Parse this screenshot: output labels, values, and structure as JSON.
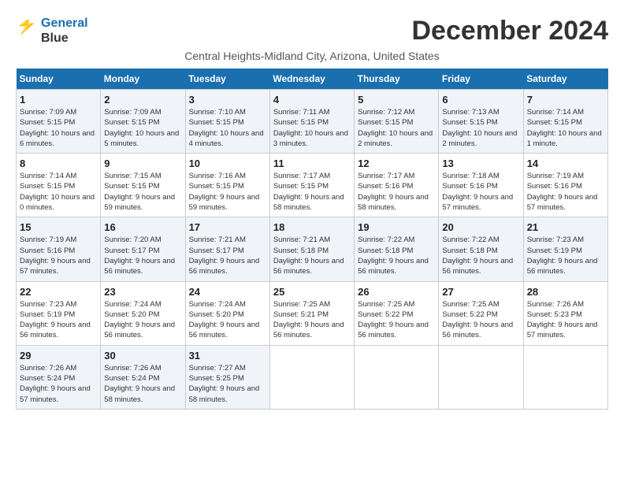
{
  "logo": {
    "line1": "General",
    "line2": "Blue"
  },
  "title": "December 2024",
  "subtitle": "Central Heights-Midland City, Arizona, United States",
  "header": {
    "colors": {
      "accent": "#1a6faf"
    }
  },
  "weekdays": [
    "Sunday",
    "Monday",
    "Tuesday",
    "Wednesday",
    "Thursday",
    "Friday",
    "Saturday"
  ],
  "weeks": [
    [
      {
        "day": "1",
        "sunrise": "7:09 AM",
        "sunset": "5:15 PM",
        "daylight": "10 hours and 6 minutes."
      },
      {
        "day": "2",
        "sunrise": "7:09 AM",
        "sunset": "5:15 PM",
        "daylight": "10 hours and 5 minutes."
      },
      {
        "day": "3",
        "sunrise": "7:10 AM",
        "sunset": "5:15 PM",
        "daylight": "10 hours and 4 minutes."
      },
      {
        "day": "4",
        "sunrise": "7:11 AM",
        "sunset": "5:15 PM",
        "daylight": "10 hours and 3 minutes."
      },
      {
        "day": "5",
        "sunrise": "7:12 AM",
        "sunset": "5:15 PM",
        "daylight": "10 hours and 2 minutes."
      },
      {
        "day": "6",
        "sunrise": "7:13 AM",
        "sunset": "5:15 PM",
        "daylight": "10 hours and 2 minutes."
      },
      {
        "day": "7",
        "sunrise": "7:14 AM",
        "sunset": "5:15 PM",
        "daylight": "10 hours and 1 minute."
      }
    ],
    [
      {
        "day": "8",
        "sunrise": "7:14 AM",
        "sunset": "5:15 PM",
        "daylight": "10 hours and 0 minutes."
      },
      {
        "day": "9",
        "sunrise": "7:15 AM",
        "sunset": "5:15 PM",
        "daylight": "9 hours and 59 minutes."
      },
      {
        "day": "10",
        "sunrise": "7:16 AM",
        "sunset": "5:15 PM",
        "daylight": "9 hours and 59 minutes."
      },
      {
        "day": "11",
        "sunrise": "7:17 AM",
        "sunset": "5:15 PM",
        "daylight": "9 hours and 58 minutes."
      },
      {
        "day": "12",
        "sunrise": "7:17 AM",
        "sunset": "5:16 PM",
        "daylight": "9 hours and 58 minutes."
      },
      {
        "day": "13",
        "sunrise": "7:18 AM",
        "sunset": "5:16 PM",
        "daylight": "9 hours and 57 minutes."
      },
      {
        "day": "14",
        "sunrise": "7:19 AM",
        "sunset": "5:16 PM",
        "daylight": "9 hours and 57 minutes."
      }
    ],
    [
      {
        "day": "15",
        "sunrise": "7:19 AM",
        "sunset": "5:16 PM",
        "daylight": "9 hours and 57 minutes."
      },
      {
        "day": "16",
        "sunrise": "7:20 AM",
        "sunset": "5:17 PM",
        "daylight": "9 hours and 56 minutes."
      },
      {
        "day": "17",
        "sunrise": "7:21 AM",
        "sunset": "5:17 PM",
        "daylight": "9 hours and 56 minutes."
      },
      {
        "day": "18",
        "sunrise": "7:21 AM",
        "sunset": "5:18 PM",
        "daylight": "9 hours and 56 minutes."
      },
      {
        "day": "19",
        "sunrise": "7:22 AM",
        "sunset": "5:18 PM",
        "daylight": "9 hours and 56 minutes."
      },
      {
        "day": "20",
        "sunrise": "7:22 AM",
        "sunset": "5:18 PM",
        "daylight": "9 hours and 56 minutes."
      },
      {
        "day": "21",
        "sunrise": "7:23 AM",
        "sunset": "5:19 PM",
        "daylight": "9 hours and 56 minutes."
      }
    ],
    [
      {
        "day": "22",
        "sunrise": "7:23 AM",
        "sunset": "5:19 PM",
        "daylight": "9 hours and 56 minutes."
      },
      {
        "day": "23",
        "sunrise": "7:24 AM",
        "sunset": "5:20 PM",
        "daylight": "9 hours and 56 minutes."
      },
      {
        "day": "24",
        "sunrise": "7:24 AM",
        "sunset": "5:20 PM",
        "daylight": "9 hours and 56 minutes."
      },
      {
        "day": "25",
        "sunrise": "7:25 AM",
        "sunset": "5:21 PM",
        "daylight": "9 hours and 56 minutes."
      },
      {
        "day": "26",
        "sunrise": "7:25 AM",
        "sunset": "5:22 PM",
        "daylight": "9 hours and 56 minutes."
      },
      {
        "day": "27",
        "sunrise": "7:25 AM",
        "sunset": "5:22 PM",
        "daylight": "9 hours and 56 minutes."
      },
      {
        "day": "28",
        "sunrise": "7:26 AM",
        "sunset": "5:23 PM",
        "daylight": "9 hours and 57 minutes."
      }
    ],
    [
      {
        "day": "29",
        "sunrise": "7:26 AM",
        "sunset": "5:24 PM",
        "daylight": "9 hours and 57 minutes."
      },
      {
        "day": "30",
        "sunrise": "7:26 AM",
        "sunset": "5:24 PM",
        "daylight": "9 hours and 58 minutes."
      },
      {
        "day": "31",
        "sunrise": "7:27 AM",
        "sunset": "5:25 PM",
        "daylight": "9 hours and 58 minutes."
      },
      null,
      null,
      null,
      null
    ]
  ],
  "labels": {
    "sunrise": "Sunrise:",
    "sunset": "Sunset:",
    "daylight": "Daylight:"
  }
}
